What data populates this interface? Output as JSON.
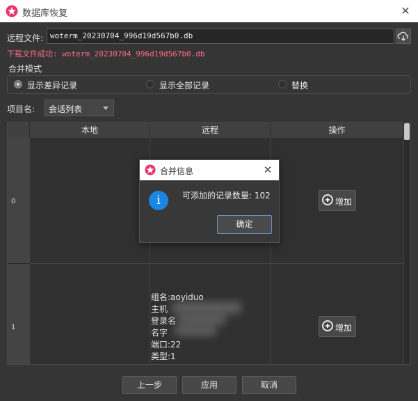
{
  "window": {
    "title": "数据库恢复",
    "accent": "#e8336f"
  },
  "remote_file": {
    "label": "远程文件:",
    "value": "woterm_20230704_996d19d567b0.db"
  },
  "download_status": "下载文件成功: woterm_20230704_996d19d567b0.db",
  "merge_mode": {
    "label": "合并模式",
    "options": [
      "显示差异记录",
      "显示全部记录",
      "替换"
    ],
    "selected": "显示差异记录"
  },
  "project": {
    "label": "项目名:",
    "selected": "会话列表"
  },
  "table": {
    "headers": [
      "本地",
      "远程",
      "操作"
    ],
    "rows": [
      {
        "index": "0",
        "remote": [],
        "action": "增加"
      },
      {
        "index": "1",
        "remote": [
          "组名:aoyiduo",
          "主机",
          "登录名",
          "名字",
          "端口:22",
          "类型:1"
        ],
        "action": "增加"
      }
    ]
  },
  "buttons": {
    "prev": "上一步",
    "apply": "应用",
    "cancel": "取消"
  },
  "dialog": {
    "title": "合并信息",
    "message": "可添加的记录数量: 102",
    "ok": "确定",
    "icon": "info-icon",
    "icon_color": "#1b86e3"
  }
}
